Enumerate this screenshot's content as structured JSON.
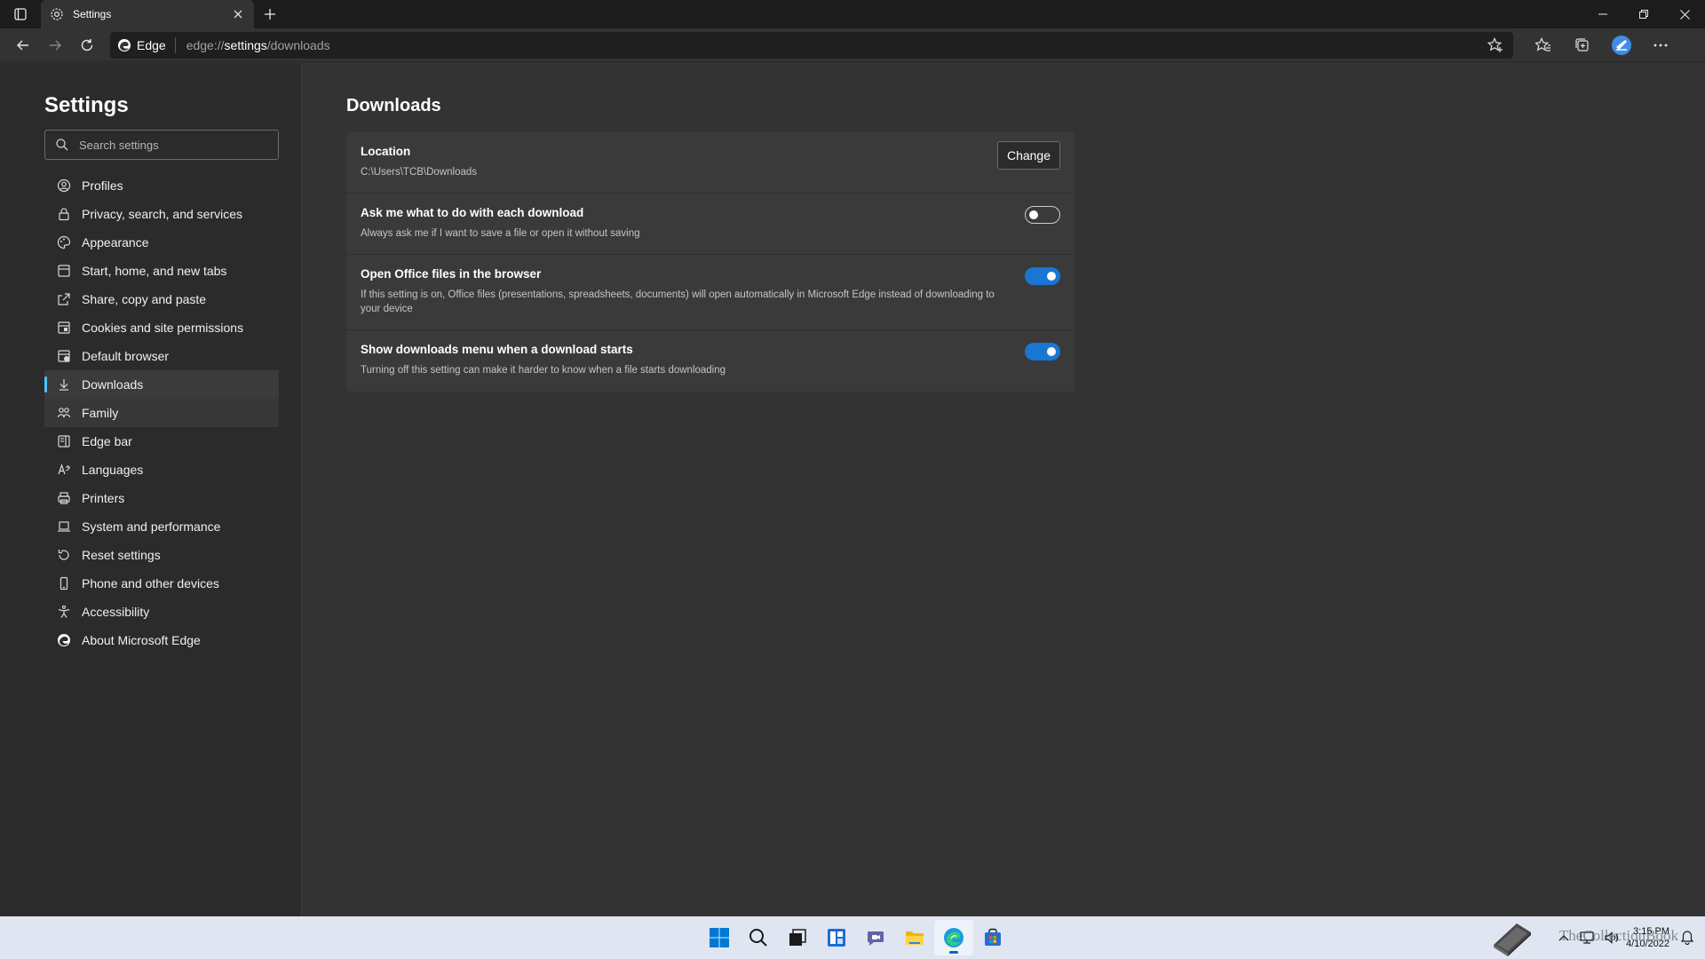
{
  "tab": {
    "title": "Settings"
  },
  "omnibox": {
    "site_label": "Edge",
    "url_prefix": "edge://",
    "url_highlight": "settings",
    "url_suffix": "/downloads"
  },
  "sidebar": {
    "title": "Settings",
    "search_placeholder": "Search settings",
    "items": [
      {
        "label": "Profiles",
        "icon": "profile-icon"
      },
      {
        "label": "Privacy, search, and services",
        "icon": "lock-icon"
      },
      {
        "label": "Appearance",
        "icon": "palette-icon"
      },
      {
        "label": "Start, home, and new tabs",
        "icon": "home-icon"
      },
      {
        "label": "Share, copy and paste",
        "icon": "share-icon"
      },
      {
        "label": "Cookies and site permissions",
        "icon": "cookie-icon"
      },
      {
        "label": "Default browser",
        "icon": "browser-icon"
      },
      {
        "label": "Downloads",
        "icon": "download-icon"
      },
      {
        "label": "Family",
        "icon": "family-icon"
      },
      {
        "label": "Edge bar",
        "icon": "edge-bar-icon"
      },
      {
        "label": "Languages",
        "icon": "language-icon"
      },
      {
        "label": "Printers",
        "icon": "printer-icon"
      },
      {
        "label": "System and performance",
        "icon": "laptop-icon"
      },
      {
        "label": "Reset settings",
        "icon": "reset-icon"
      },
      {
        "label": "Phone and other devices",
        "icon": "phone-icon"
      },
      {
        "label": "Accessibility",
        "icon": "accessibility-icon"
      },
      {
        "label": "About Microsoft Edge",
        "icon": "edge-logo-icon"
      }
    ],
    "active_index": 7,
    "hover_index": 8
  },
  "main": {
    "title": "Downloads",
    "location": {
      "title": "Location",
      "path": "C:\\Users\\TCB\\Downloads",
      "button": "Change"
    },
    "settings": [
      {
        "title": "Ask me what to do with each download",
        "desc": "Always ask me if I want to save a file or open it without saving",
        "enabled": false
      },
      {
        "title": "Open Office files in the browser",
        "desc": "If this setting is on, Office files (presentations, spreadsheets, documents) will open automatically in Microsoft Edge instead of downloading to your device",
        "enabled": true
      },
      {
        "title": "Show downloads menu when a download starts",
        "desc": "Turning off this setting can make it harder to know when a file starts downloading",
        "enabled": true
      }
    ]
  },
  "taskbar": {
    "watermark": "TheCollectionBook",
    "time": "3:15 PM",
    "date": "4/10/2022"
  },
  "colors": {
    "accent": "#1976d2",
    "active_indicator": "#4cc2ff",
    "sidebar_bg": "#2b2b2b",
    "content_bg": "#333333",
    "card_bg": "#3a3a3a"
  }
}
